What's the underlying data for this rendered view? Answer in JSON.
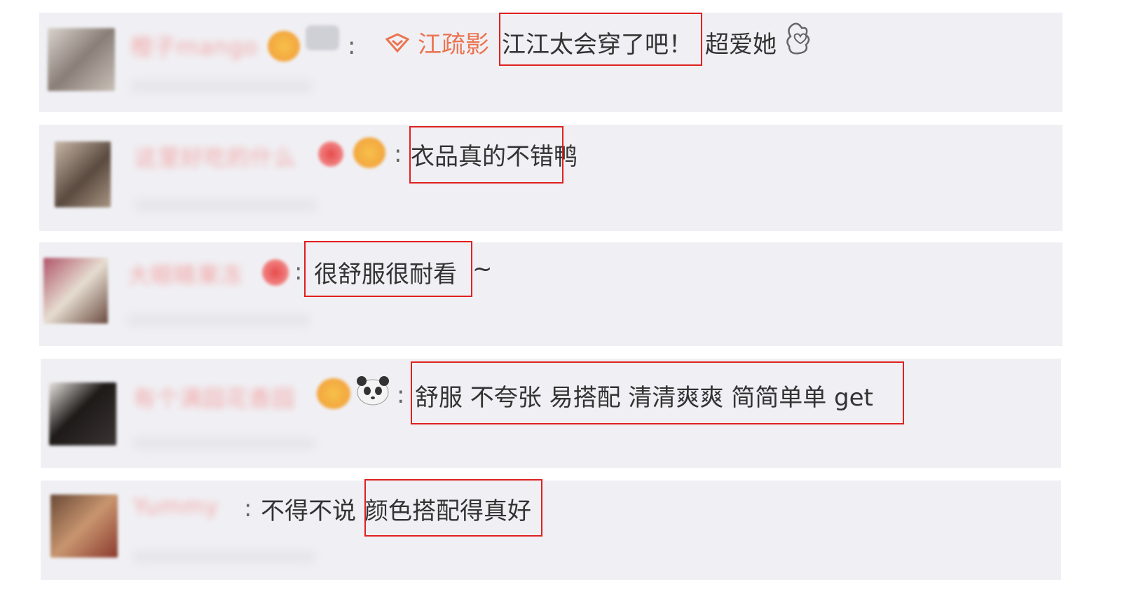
{
  "comments": [
    {
      "mention": "江疏影",
      "highlight": "江江太会穿了吧！",
      "rest": "超爱她",
      "emoji": "hand-heart-emoji"
    },
    {
      "highlight": "衣品真的不错",
      "rest": "鸭"
    },
    {
      "highlight": "很舒服很耐看",
      "rest": "~"
    },
    {
      "highlight": "舒服 不夸张 易搭配 清清爽爽 简简单单 get",
      "emoji": "panda-emoji"
    },
    {
      "pre": "不得不说",
      "highlight": "颜色搭配得真好"
    }
  ],
  "colors": {
    "row_bg": "#f0f0f4",
    "highlight_border": "#e02020",
    "mention_color": "#eb7350",
    "text_color": "#333333"
  }
}
